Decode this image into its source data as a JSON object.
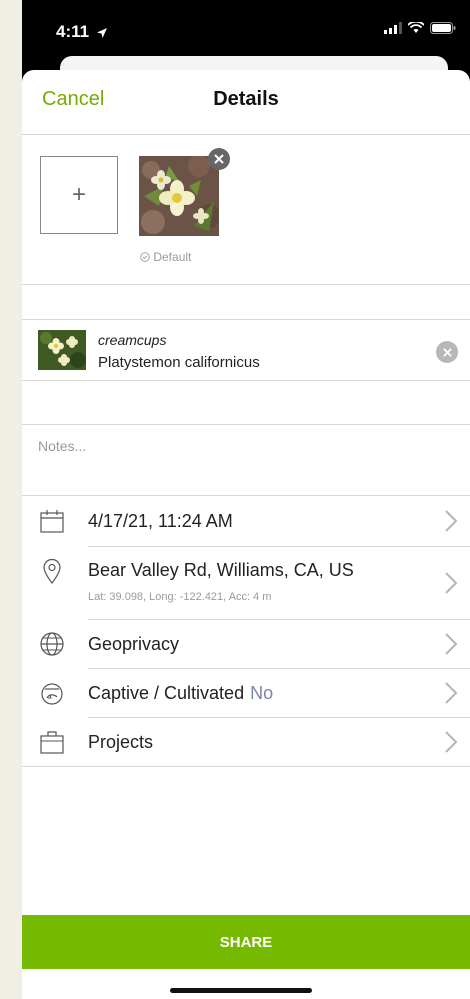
{
  "status_bar": {
    "time": "4:11"
  },
  "nav": {
    "cancel_label": "Cancel",
    "title": "Details"
  },
  "photos": {
    "add_label": "+",
    "default_label": "Default"
  },
  "taxon": {
    "common_name": "creamcups",
    "scientific_name": "Platystemon californicus"
  },
  "notes": {
    "placeholder": "Notes..."
  },
  "details": {
    "date": "4/17/21, 11:24 AM",
    "location": "Bear Valley Rd, Williams, CA, US",
    "location_coords": "Lat: 39.098, Long: -122.421, Acc: 4 m",
    "geoprivacy": "Geoprivacy",
    "captive_label": "Captive / Cultivated",
    "captive_value": "No",
    "projects": "Projects"
  },
  "share": {
    "label": "SHARE"
  },
  "colors": {
    "accent": "#74ac00",
    "share_bg": "#75b900",
    "value_blue": "#7b86a6"
  },
  "icons": [
    "location-arrow-icon",
    "signal-icon",
    "wifi-icon",
    "battery-icon",
    "calendar-icon",
    "map-pin-icon",
    "globe-icon",
    "captive-pot-icon",
    "briefcase-icon",
    "chevron-right-icon",
    "close-icon",
    "check-circle-icon"
  ]
}
